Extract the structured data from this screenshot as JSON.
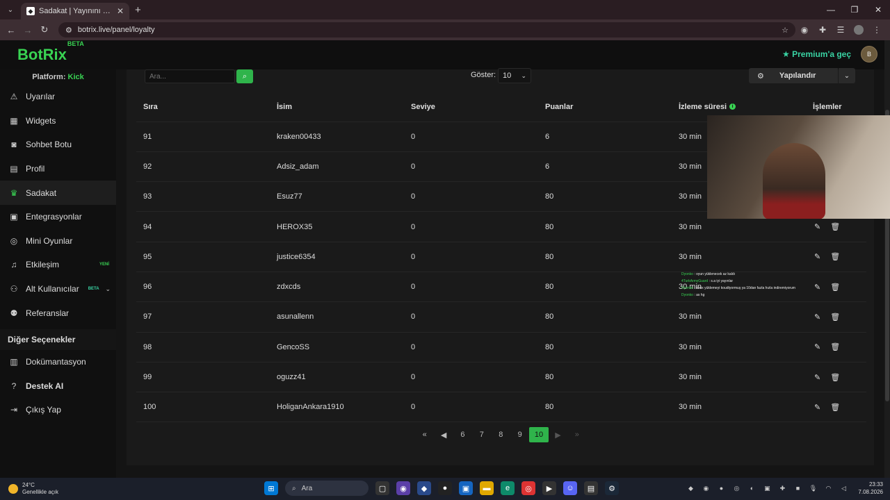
{
  "browser": {
    "tab_title": "Sadakat | Yayınını güçlendirmek",
    "url": "botrix.live/panel/loyalty"
  },
  "header": {
    "logo": "BotRix",
    "logo_badge": "BETA",
    "premium": "Premium'a geç",
    "avatar": "B"
  },
  "sidebar": {
    "platform_label": "Platform:",
    "platform_value": "Kick",
    "items": [
      {
        "label": "Uyarılar",
        "icon": "warning-icon"
      },
      {
        "label": "Widgets",
        "icon": "grid-icon"
      },
      {
        "label": "Sohbet Botu",
        "icon": "robot-icon"
      },
      {
        "label": "Profil",
        "icon": "id-card-icon"
      },
      {
        "label": "Sadakat",
        "icon": "trophy-icon"
      },
      {
        "label": "Entegrasyonlar",
        "icon": "plug-icon"
      },
      {
        "label": "Mini Oyunlar",
        "icon": "gamepad-icon"
      },
      {
        "label": "Etkileşim",
        "icon": "music-icon",
        "badge": "YENİ"
      },
      {
        "label": "Alt Kullanıcılar",
        "icon": "users-icon",
        "badge": "BETA"
      },
      {
        "label": "Referanslar",
        "icon": "user-friends-icon"
      }
    ],
    "section_title": "Diğer Seçenekler",
    "other_items": [
      {
        "label": "Dokümantasyon",
        "icon": "book-icon"
      },
      {
        "label": "Destek AI",
        "icon": "question-icon"
      },
      {
        "label": "Çıkış Yap",
        "icon": "logout-icon"
      }
    ]
  },
  "toolbar": {
    "search_placeholder": "Ara...",
    "show_label": "Göster:",
    "show_value": "10",
    "configure_label": "Yapılandır"
  },
  "table": {
    "headers": [
      "Sıra",
      "İsim",
      "Seviye",
      "Puanlar",
      "İzleme süresi",
      "İşlemler"
    ],
    "rows": [
      {
        "rank": "91",
        "name": "kraken00433",
        "level": "0",
        "points": "6",
        "watch": "30 min"
      },
      {
        "rank": "92",
        "name": "Adsiz_adam",
        "level": "0",
        "points": "6",
        "watch": "30 min"
      },
      {
        "rank": "93",
        "name": "Esuz77",
        "level": "0",
        "points": "80",
        "watch": "30 min"
      },
      {
        "rank": "94",
        "name": "HEROX35",
        "level": "0",
        "points": "80",
        "watch": "30 min"
      },
      {
        "rank": "95",
        "name": "justice6354",
        "level": "0",
        "points": "80",
        "watch": "30 min"
      },
      {
        "rank": "96",
        "name": "zdxcds",
        "level": "0",
        "points": "80",
        "watch": "30 min"
      },
      {
        "rank": "97",
        "name": "asunallenn",
        "level": "0",
        "points": "80",
        "watch": "30 min"
      },
      {
        "rank": "98",
        "name": "GencoSS",
        "level": "0",
        "points": "80",
        "watch": "30 min"
      },
      {
        "rank": "99",
        "name": "oguzz41",
        "level": "0",
        "points": "80",
        "watch": "30 min"
      },
      {
        "rank": "100",
        "name": "HoliganAnkara1910",
        "level": "0",
        "points": "80",
        "watch": "30 min"
      }
    ]
  },
  "pagination": {
    "pages": [
      "6",
      "7",
      "8",
      "9",
      "10"
    ],
    "current": "10"
  },
  "overlay_chat": [
    {
      "user": "Dyonko",
      "text": ": oyun yüklenecek az kaldı"
    },
    {
      "user": "4TurkArmyGuard",
      "text": ": s.a iyi yayınlar"
    },
    {
      "user": "Dyonko",
      "text": ": xbox yüklemeyi koudtyormuş ya 10dan fazla hızla indiremiyorum"
    },
    {
      "user": "Dyonko",
      "text": ": as hg"
    }
  ],
  "taskbar": {
    "temp": "24°C",
    "weather": "Genellikle açık",
    "search": "Ara",
    "time": "23:33",
    "date": "7.08.2026"
  },
  "colors": {
    "accent": "#39d353",
    "background": "#1a1a1a"
  }
}
